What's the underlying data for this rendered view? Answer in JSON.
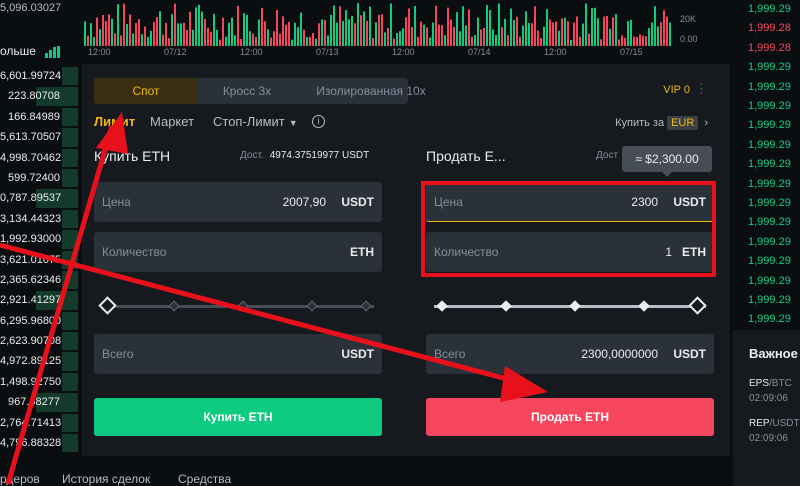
{
  "left_panel": {
    "top_value": "5,096.03027",
    "more_label": "ольше",
    "rows": [
      "6,601.99724",
      "223.80708",
      "166.84989",
      "5,613.70507",
      "4,998.70462",
      "599.72400",
      "0,787.89537",
      "3,134.44323",
      "1,992.93000",
      "3,621.01075",
      "2,365.62346",
      "2,921.41297",
      "6,295.96800",
      "2,623.90708",
      "4,972.89125",
      "1,498.92750",
      "967.68277",
      "2,764.71413",
      "4,796.88328"
    ]
  },
  "chart": {
    "time_labels": [
      "12:00",
      "07/12",
      "12:00",
      "07/13",
      "12:00",
      "07/14",
      "12:00",
      "07/15"
    ],
    "vol_labels": [
      "20K",
      "0.00"
    ],
    "colors": {
      "up": "#0ecb81",
      "down": "#f6465d"
    }
  },
  "right_prices": [
    "1,999.29",
    "1,999.28",
    "1,999.28",
    "1,999.29",
    "1,999.29",
    "1,999.29",
    "1,999.29",
    "1,999.29",
    "1,999.29",
    "1,999.29",
    "1,999.29",
    "1,999.29",
    "1,999.29",
    "1,999.29",
    "1,999.29",
    "1,999.29",
    "1,999.29"
  ],
  "news": {
    "title": "Важное",
    "items": [
      {
        "sym": "EPS",
        "pair": "/BTC",
        "time": "02:09:06"
      },
      {
        "sym": "REP",
        "pair": "/USDT",
        "time": "02:09:06"
      }
    ]
  },
  "panel": {
    "tabs": [
      "Спот",
      "Кросс 3x",
      "Изолированная 10x"
    ],
    "vip": "VIP 0",
    "order_types": {
      "limit": "Лимит",
      "market": "Маркет",
      "stop_limit": "Стоп-Лимит"
    },
    "buy_with": "Купить за",
    "currency": "EUR",
    "buy": {
      "title": "Купить ETH",
      "avail_label": "Дост.",
      "avail_value": "4974.37519977 USDT",
      "price_label": "Цена",
      "price_value": "2007,90",
      "price_unit": "USDT",
      "qty_label": "Количество",
      "qty_unit": "ETH",
      "total_label": "Всего",
      "total_unit": "USDT",
      "button": "Купить ETH"
    },
    "sell": {
      "title": "Продать Е...",
      "avail_label": "Дост",
      "tooltip": "≈ $2,300.00",
      "price_label": "Цена",
      "price_value": "2300",
      "price_unit": "USDT",
      "qty_label": "Количество",
      "qty_value": "1",
      "qty_unit": "ETH",
      "total_label": "Всего",
      "total_value": "2300,0000000",
      "total_unit": "USDT",
      "button": "Продать ETH"
    }
  },
  "bottom_tabs": [
    "рдеров",
    "История сделок",
    "Средства"
  ],
  "annotation_color": "#e8101a"
}
